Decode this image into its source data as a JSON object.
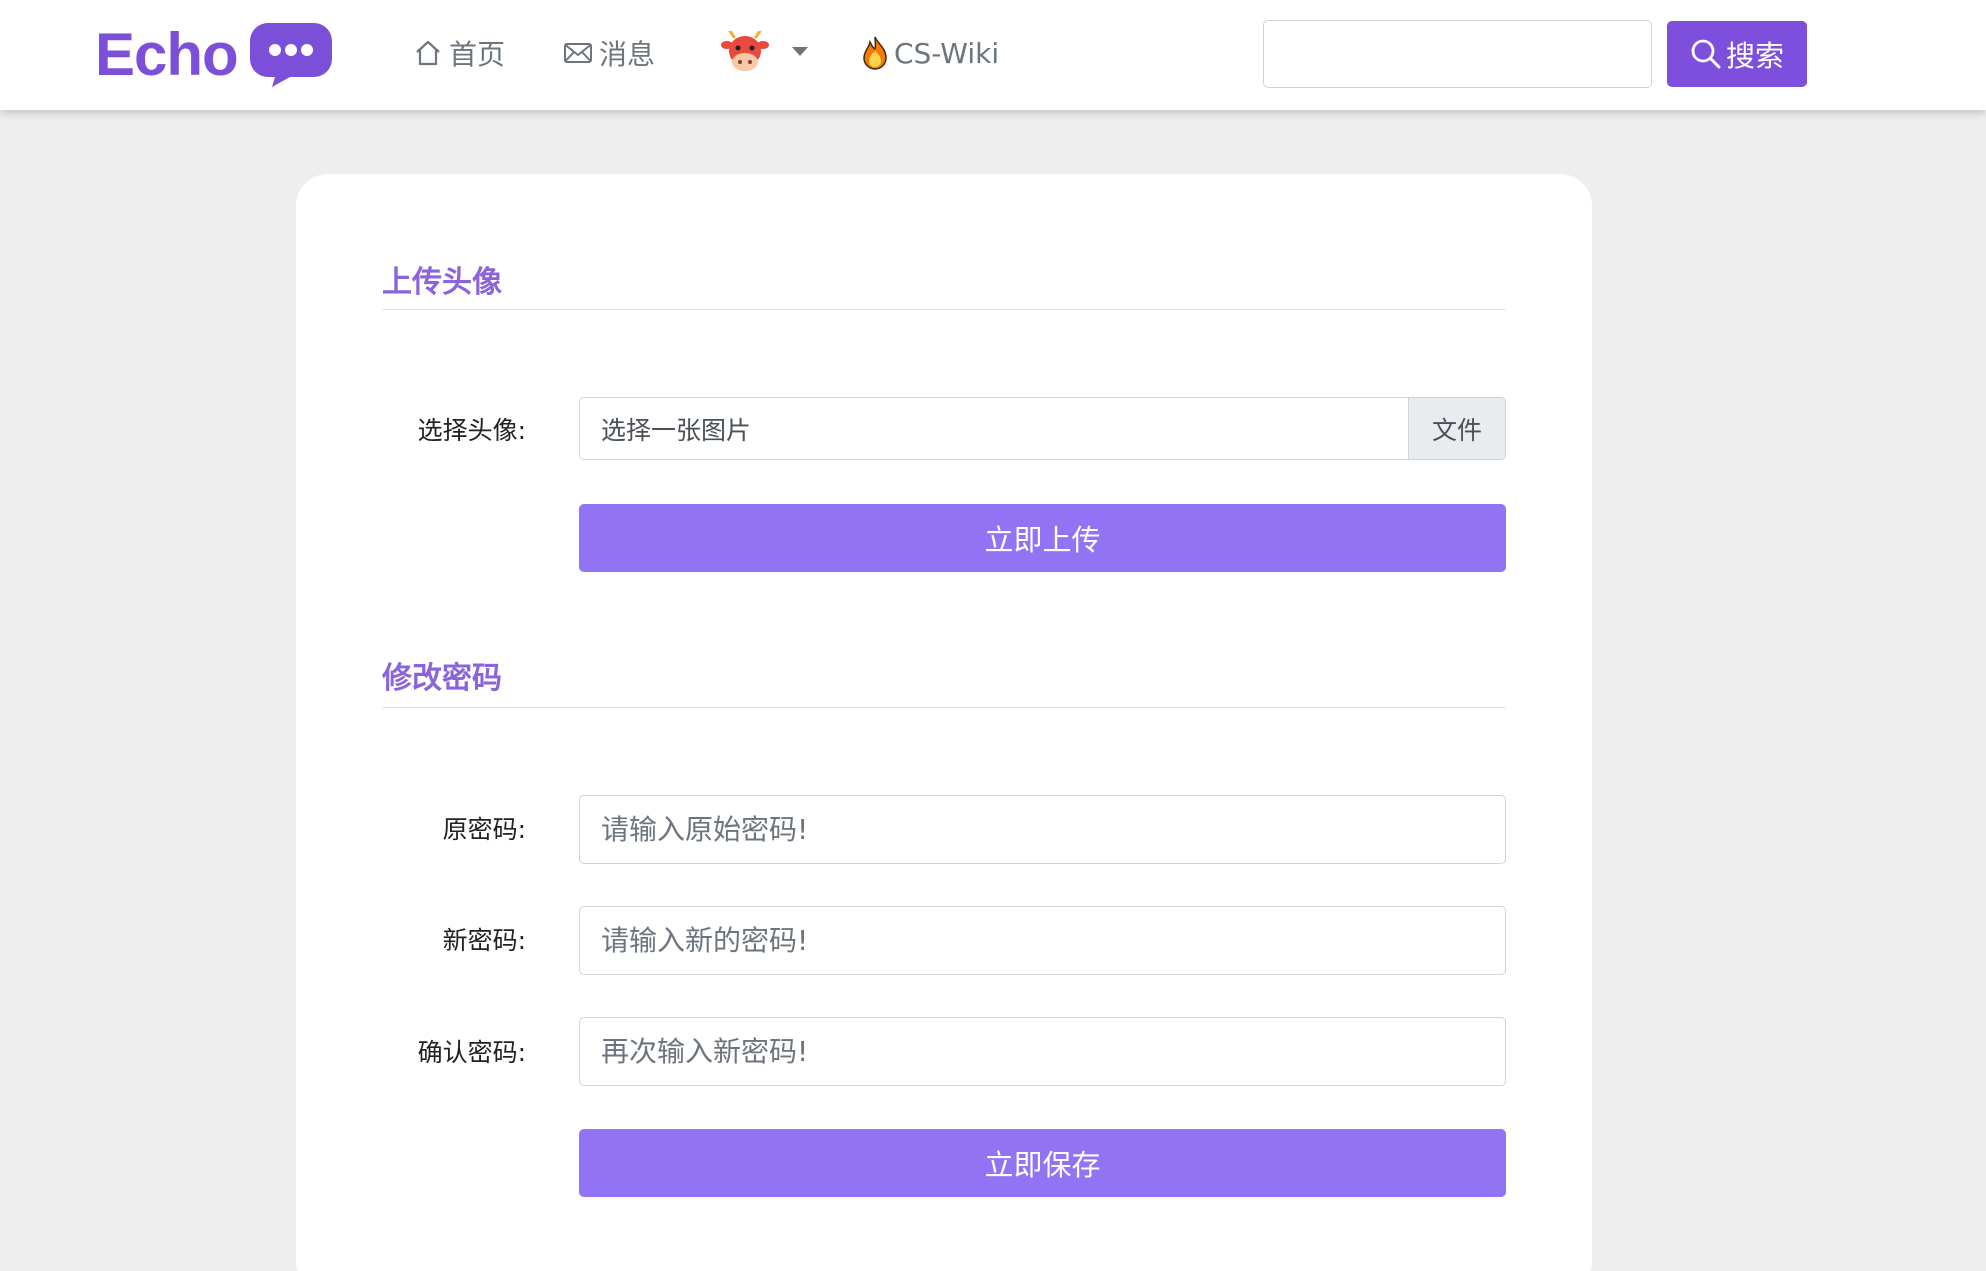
{
  "header": {
    "brand": "Echo",
    "nav": {
      "home": "首页",
      "messages": "消息",
      "wiki": "CS-Wiki"
    },
    "search": {
      "value": "",
      "placeholder": "",
      "button_label": "搜索"
    },
    "icons": {
      "home": "home-icon",
      "messages": "envelope-icon",
      "user": "cow-avatar-icon",
      "dropdown": "caret-down-icon",
      "wiki": "fire-icon",
      "search": "search-icon"
    }
  },
  "avatar_section": {
    "title": "上传头像",
    "file_label": "选择头像:",
    "file_placeholder": "选择一张图片",
    "file_button": "文件",
    "upload_button": "立即上传"
  },
  "password_section": {
    "title": "修改密码",
    "old_label": "原密码:",
    "old_placeholder": "请输入原始密码!",
    "new_label": "新密码:",
    "new_placeholder": "请输入新的密码!",
    "confirm_label": "确认密码:",
    "confirm_placeholder": "再次输入新密码!",
    "save_button": "立即保存"
  },
  "colors": {
    "brand": "#7b4fd8",
    "primary_button": "#9273f3",
    "search_button": "#7d4fdc",
    "section_title": "#8a63dd",
    "page_background": "#eeeeee"
  }
}
